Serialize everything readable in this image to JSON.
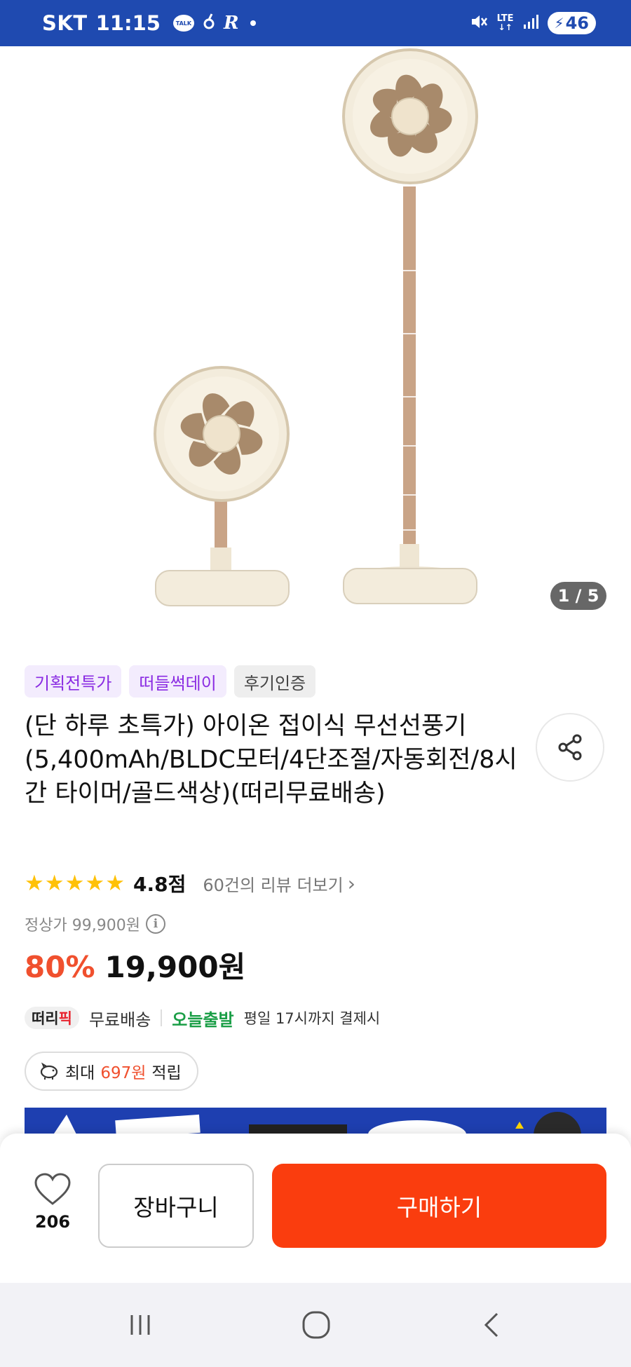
{
  "status_bar": {
    "carrier": "SKT",
    "time": "11:15",
    "talk_badge": "TALK",
    "extra_glyph": "R",
    "network": "LTE",
    "battery": "46",
    "icons": [
      "kakaotalk-icon",
      "app-notification-icon",
      "mute-icon",
      "lte-icon",
      "signal-icon",
      "battery-charging-icon"
    ]
  },
  "gallery": {
    "counter": "1 / 5",
    "colors": {
      "fan_body": "#efe6d3",
      "fan_blade": "#a88a6b",
      "pole": "#c9a487"
    }
  },
  "product": {
    "tags": [
      "기획전특가",
      "떠들썩데이",
      "후기인증"
    ],
    "title": "(단 하루 초특가) 아이온 접이식 무선선풍기(5,400mAh/BLDC모터/4단조절/자동회전/8시간 타이머/골드색상)(떠리무료배송)",
    "rating": {
      "stars": 5,
      "score": "4.8점",
      "reviews_link": "60건의 리뷰 더보기"
    },
    "regular_price": "정상가 99,900원",
    "discount": "80%",
    "sale_price": "19,900원"
  },
  "shipping": {
    "logo_prefix": "떠리",
    "logo_suffix": "픽",
    "free_label": "무료배송",
    "today_label": "오늘출발",
    "note": "평일 17시까지 결제시"
  },
  "points": {
    "prefix": "최대",
    "amount": "697원",
    "suffix": "적립"
  },
  "action_bar": {
    "like_count": "206",
    "cart_label": "장바구니",
    "buy_label": "구매하기"
  },
  "nav_bar": {
    "icons": [
      "recent-apps-icon",
      "home-icon",
      "back-icon"
    ]
  },
  "colors": {
    "accent": "#fa3d0e",
    "discount": "#f0502e",
    "status_bar": "#1f4ab0",
    "tag_purple": "#8a2be2",
    "today_green": "#1a9e46",
    "star": "#ffc107"
  }
}
